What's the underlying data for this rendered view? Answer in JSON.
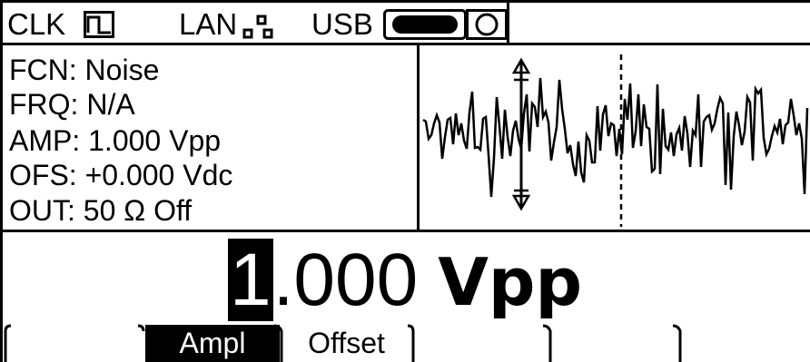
{
  "status_bar": {
    "clk_label": "CLK",
    "lan_label": "LAN",
    "usb_label": "USB",
    "icons": [
      "clock-source-icon",
      "lan-network-icon",
      "usb-plug-icon",
      "usb-memory-icon"
    ]
  },
  "params": [
    {
      "name": "FCN:",
      "value": "Noise"
    },
    {
      "name": "FRQ:",
      "value": "N/A"
    },
    {
      "name": "AMP:",
      "value": "1.000 Vpp"
    },
    {
      "name": "OFS:",
      "value": "+0.000 Vdc"
    },
    {
      "name": "OUT:",
      "value": "50 Ω Off"
    }
  ],
  "edit_value": {
    "cursor_digit": "1",
    "rest": ".000",
    "unit": "Vpp"
  },
  "softkeys": [
    {
      "label": "",
      "active": false
    },
    {
      "label": "Ampl",
      "active": true
    },
    {
      "label": "Offset",
      "active": false
    },
    {
      "label": "",
      "active": false
    },
    {
      "label": "",
      "active": false
    },
    {
      "label": "",
      "active": false
    }
  ],
  "waveform_preview": {
    "type": "noise"
  }
}
